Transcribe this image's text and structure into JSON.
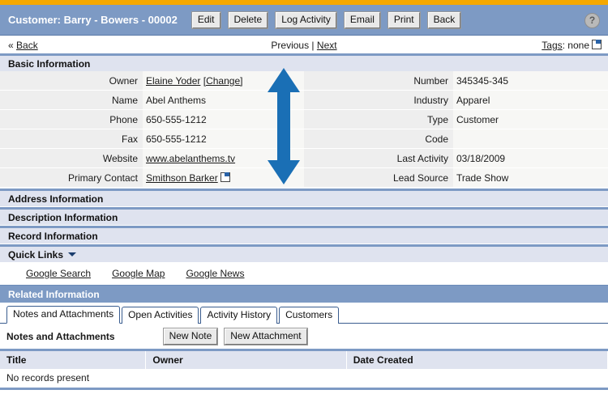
{
  "window": {
    "title": "Customer: Barry - Bowers - 00002",
    "help_icon": "help-question-icon",
    "help_label": "?"
  },
  "toolbar": {
    "buttons": [
      {
        "label": "Edit",
        "name": "edit-button"
      },
      {
        "label": "Delete",
        "name": "delete-button"
      },
      {
        "label": "Log Activity",
        "name": "log-activity-button"
      },
      {
        "label": "Email",
        "name": "email-button"
      },
      {
        "label": "Print",
        "name": "print-button"
      },
      {
        "label": "Back",
        "name": "back-button"
      }
    ]
  },
  "nav": {
    "back_label": "« Back",
    "back_chevron": "«",
    "back_text": "Back",
    "previous_label": "Previous",
    "separator": " | ",
    "next_label": "Next",
    "tags_label": "Tags",
    "tags_colon": ": ",
    "tags_value": "none"
  },
  "sections": {
    "basic": {
      "title": "Basic Information",
      "left_fields": [
        {
          "label": "Owner",
          "value": "Elaine Yoder",
          "link": true,
          "suffix": "[Change]",
          "suffix_link": true
        },
        {
          "label": "Name",
          "value": "Abel Anthems",
          "link": false
        },
        {
          "label": "Phone",
          "value": "650-555-1212",
          "link": false
        },
        {
          "label": "Fax",
          "value": "650-555-1212",
          "link": false
        },
        {
          "label": "Website",
          "value": "www.abelanthems.tv",
          "link": true
        },
        {
          "label": "Primary Contact",
          "value": "Smithson Barker",
          "link": true,
          "popup_icon": true
        }
      ],
      "right_fields": [
        {
          "label": "Number",
          "value": "345345-345"
        },
        {
          "label": "Industry",
          "value": "Apparel"
        },
        {
          "label": "Type",
          "value": "Customer"
        },
        {
          "label": "Code",
          "value": ""
        },
        {
          "label": "Last Activity",
          "value": "03/18/2009"
        },
        {
          "label": "Lead Source",
          "value": "Trade Show"
        }
      ]
    },
    "address": {
      "title": "Address Information"
    },
    "description": {
      "title": "Description Information"
    },
    "record": {
      "title": "Record Information"
    },
    "quick_links": {
      "title": "Quick Links",
      "links": [
        {
          "label": "Google Search",
          "name": "google-search-link"
        },
        {
          "label": "Google Map",
          "name": "google-map-link"
        },
        {
          "label": "Google News",
          "name": "google-news-link"
        }
      ]
    }
  },
  "related": {
    "title": "Related Information",
    "tabs": [
      {
        "label": "Notes and Attachments",
        "active": true
      },
      {
        "label": "Open Activities",
        "active": false
      },
      {
        "label": "Activity History",
        "active": false
      },
      {
        "label": "Customers",
        "active": false
      }
    ],
    "panel_title": "Notes and Attachments",
    "buttons": [
      {
        "label": "New Note",
        "name": "new-note-button"
      },
      {
        "label": "New Attachment",
        "name": "new-attachment-button"
      }
    ],
    "table": {
      "columns": [
        "Title",
        "Owner",
        "Date Created"
      ],
      "empty_message": "No records present",
      "rows": []
    }
  },
  "annotation": {
    "arrow": "vertical-double-headed-arrow",
    "color": "#1a6fb5"
  },
  "colors": {
    "accent_orange": "#f5a800",
    "header_blue": "#7d9ac4",
    "section_bg": "#dfe3ef",
    "label_bg": "#eeeeee",
    "value_bg": "#f7f7f5"
  }
}
